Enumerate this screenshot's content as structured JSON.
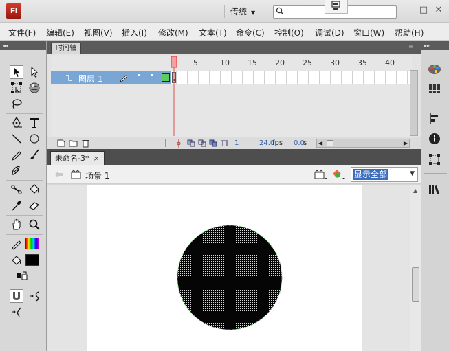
{
  "app": {
    "logo_text": "Fl",
    "workspace_label": "传统",
    "search_placeholder": ""
  },
  "menu": [
    "文件(F)",
    "编辑(E)",
    "视图(V)",
    "插入(I)",
    "修改(M)",
    "文本(T)",
    "命令(C)",
    "控制(O)",
    "调试(D)",
    "窗口(W)",
    "帮助(H)"
  ],
  "timeline": {
    "tab_label": "时间轴",
    "layer_name": "图层 1",
    "frame_numbers": [
      "1",
      "5",
      "10",
      "15",
      "20",
      "25",
      "30",
      "35",
      "40"
    ],
    "current_frame": "1",
    "fps": "24.0",
    "fps_unit": "fps",
    "time": "0.0",
    "time_unit": "s"
  },
  "document": {
    "tab_label": "未命名-3*",
    "close_glyph": "×",
    "scene_label": "场景 1",
    "zoom_value": "显示全部"
  },
  "colors": {
    "layer_selected": "#7aa6d6",
    "playhead": "#e05050",
    "stroke_swatch": "#d9a0a0",
    "fill_swatch": "#000000",
    "outline_color": "#5ccc5c"
  },
  "icons": {
    "left_toolbar": [
      "selection-tool-icon",
      "subselection-tool-icon",
      "free-transform-tool-icon",
      "3d-rotation-tool-icon",
      "lasso-tool-icon",
      "pen-tool-icon",
      "text-tool-icon",
      "line-tool-icon",
      "oval-tool-icon",
      "pencil-tool-icon",
      "brush-tool-icon",
      "deco-tool-icon",
      "bone-tool-icon",
      "paint-bucket-tool-icon",
      "eyedropper-tool-icon",
      "eraser-tool-icon",
      "hand-tool-icon",
      "zoom-tool-icon",
      "stroke-color-icon",
      "fill-color-icon",
      "snap-to-objects-icon",
      "smooth-icon",
      "straighten-icon"
    ],
    "right_toolbar": [
      "color-panel-icon",
      "swatches-panel-icon",
      "align-panel-icon",
      "info-panel-icon",
      "transform-panel-icon",
      "library-panel-icon"
    ]
  }
}
